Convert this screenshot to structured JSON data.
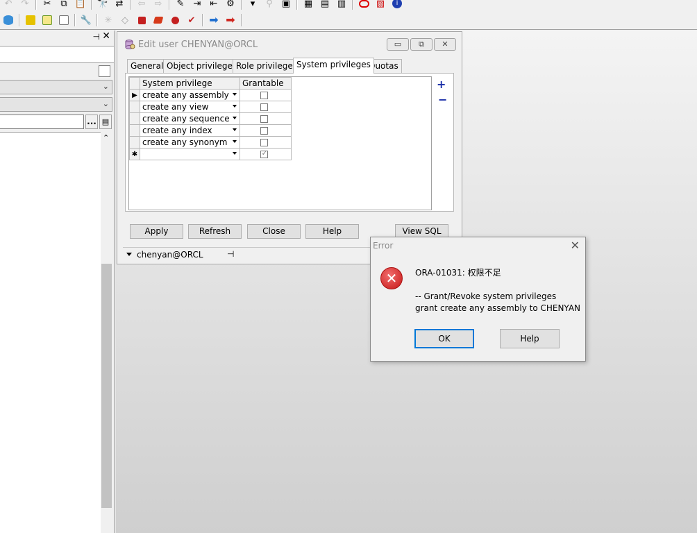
{
  "toolbar": {
    "row1_icons": [
      "undo-icon",
      "redo-icon",
      "cut-icon",
      "copy-icon",
      "paste-icon",
      "find-icon",
      "find-replace-icon",
      "back-icon",
      "forward-icon",
      "edit-icon",
      "indent-icon",
      "unindent-icon",
      "execute-icon",
      "step-icon",
      "debug-icon",
      "window-list-icon",
      "grid-icon",
      "compare-icon",
      "oracle-icon",
      "pdf-icon",
      "info-icon"
    ],
    "row2_icons": [
      "database-icon",
      "tools-icon",
      "notepad-icon",
      "document-icon",
      "wrench-icon",
      "bug-icon",
      "eraser-icon",
      "stop-icon",
      "cube-icon",
      "breakpoint-icon",
      "commit-icon",
      "rollback-icon"
    ]
  },
  "left_panel": {
    "pin_glyph": "⊣",
    "close_glyph": "✕",
    "ellipsis_label": "...",
    "filter_icon": "filter-icon"
  },
  "edit_user": {
    "title": "Edit user CHENYAN@ORCL",
    "tabs": [
      "General",
      "Object privileges",
      "Role privileges",
      "System privileges",
      "Quotas"
    ],
    "active_tab": "System privileges",
    "grid": {
      "columns": [
        "System privilege",
        "Grantable"
      ],
      "rows": [
        {
          "privilege": "create any assembly",
          "grantable": false,
          "current": true
        },
        {
          "privilege": "create any view",
          "grantable": false
        },
        {
          "privilege": "create any sequence",
          "grantable": false
        },
        {
          "privilege": "create any index",
          "grantable": false
        },
        {
          "privilege": "create any synonym",
          "grantable": false
        },
        {
          "privilege": "",
          "grantable": true,
          "new_row": true
        }
      ]
    },
    "side_buttons": {
      "add": "+",
      "remove": "−"
    },
    "buttons": {
      "apply": "Apply",
      "refresh": "Refresh",
      "close": "Close",
      "help": "Help",
      "view_sql": "View SQL"
    },
    "connection": "chenyan@ORCL"
  },
  "error_dialog": {
    "title": "Error",
    "code_line": "ORA-01031: 权限不足",
    "detail_1": "-- Grant/Revoke system privileges",
    "detail_2": "grant create any assembly to CHENYAN",
    "ok_label": "OK",
    "help_label": "Help"
  }
}
